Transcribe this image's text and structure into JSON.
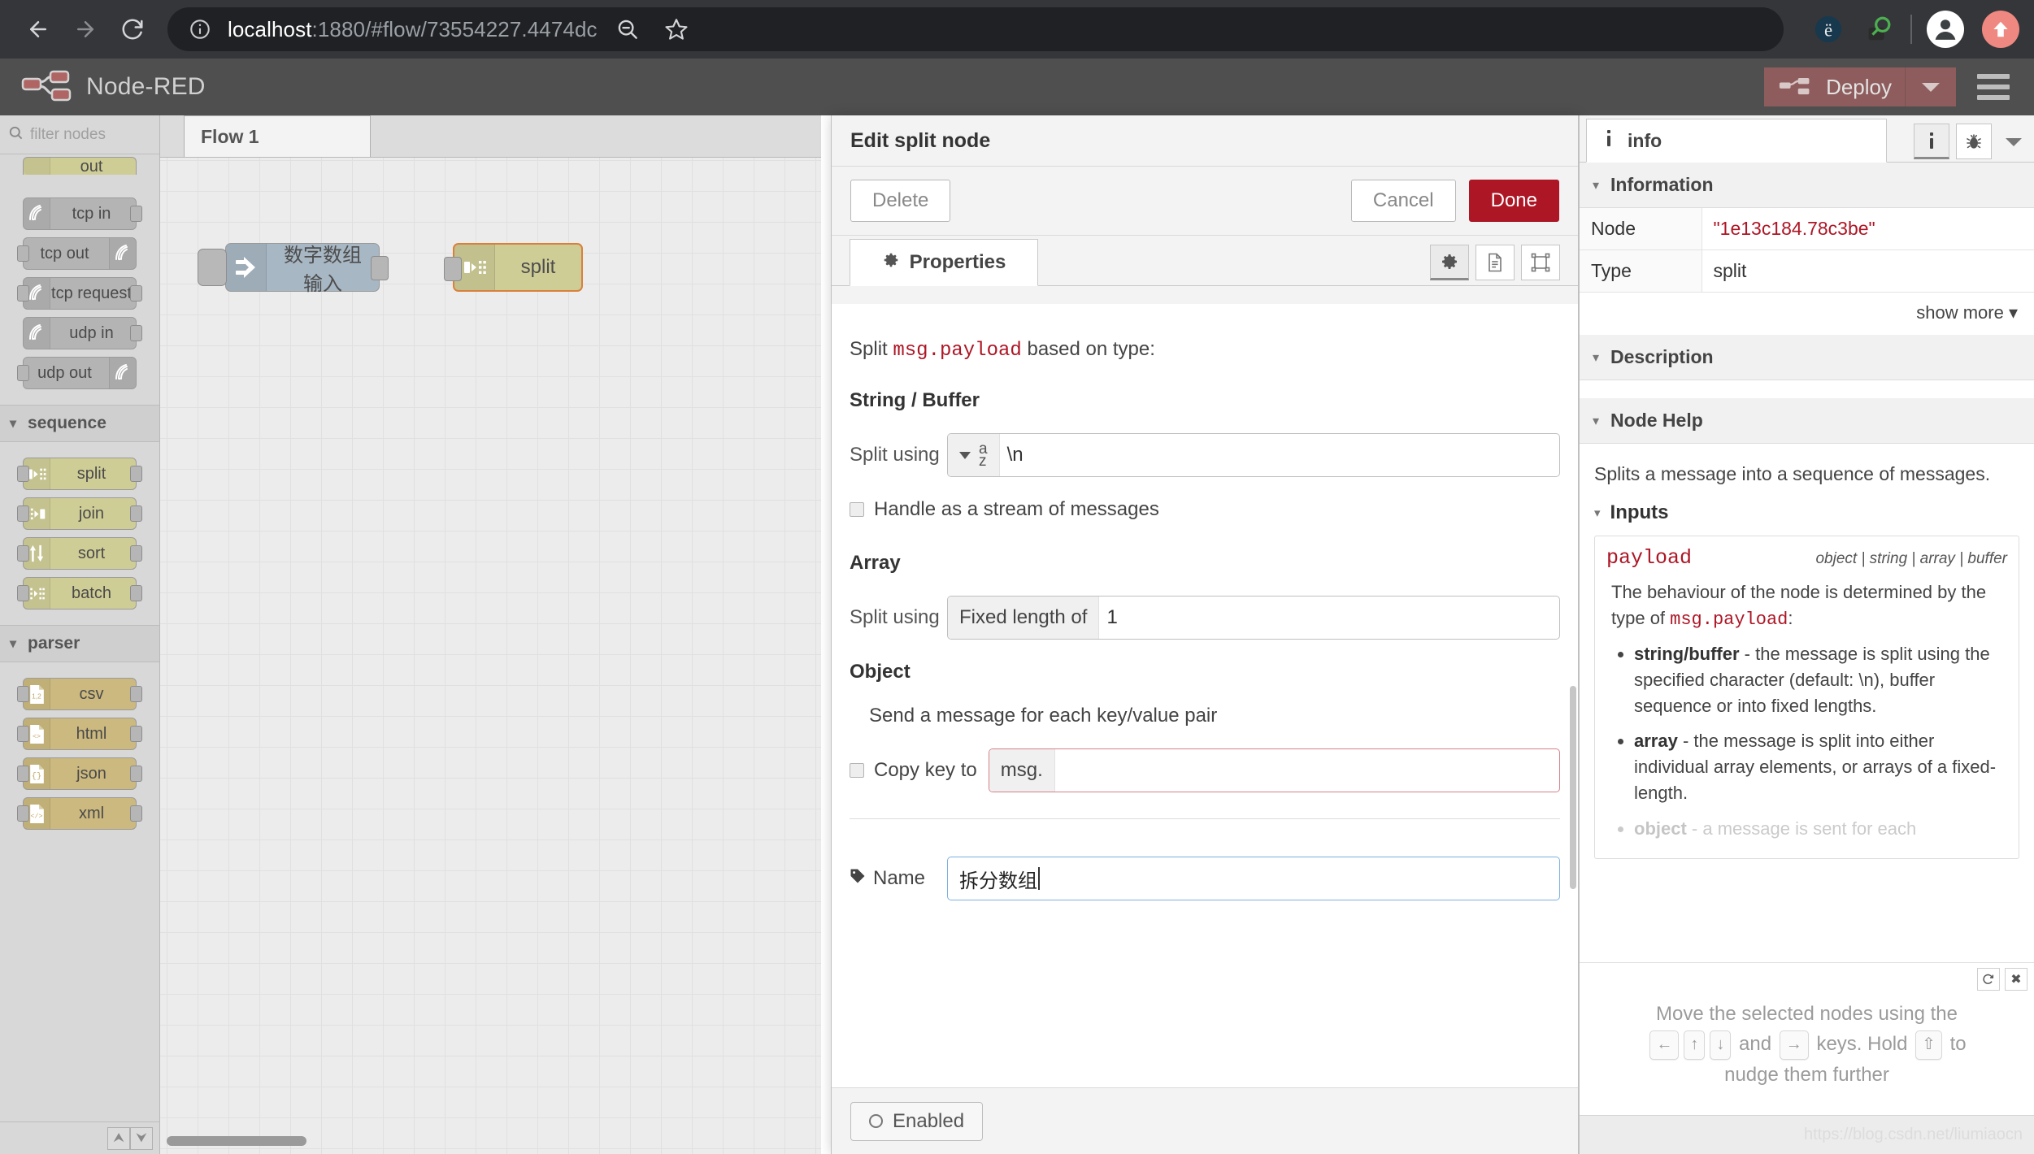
{
  "browser": {
    "url_host": "localhost",
    "url_rest": ":1880/#flow/73554227.4474dc",
    "back_icon": "back-arrow-icon",
    "forward_icon": "forward-arrow-icon",
    "reload_icon": "reload-icon",
    "site_info_icon": "site-info-icon",
    "zoom_out_icon": "zoom-out-icon",
    "bookmark_icon": "star-icon",
    "extension_e_icon": "extension-evernote-icon",
    "extension_search_icon": "extension-magnifier-icon",
    "profile_icon": "profile-avatar-icon",
    "update_icon": "update-arrow-icon"
  },
  "nr_header": {
    "title": "Node-RED",
    "logo_icon": "node-red-logo-icon",
    "deploy_label": "Deploy",
    "deploy_icon": "deploy-node-icon",
    "deploy_caret_icon": "chevron-down-icon",
    "menu_icon": "hamburger-menu-icon",
    "deploy_color": "#8e5c5c"
  },
  "palette": {
    "search_placeholder": "filter nodes",
    "search_icon": "search-icon",
    "partial_top_node": "out",
    "network_nodes": [
      {
        "label": "tcp in",
        "icon": "signal-icon",
        "color": "grey",
        "in": false,
        "out": true
      },
      {
        "label": "tcp out",
        "icon": "signal-icon",
        "color": "grey",
        "in": true,
        "out": false,
        "icon_right": true
      },
      {
        "label": "tcp request",
        "icon": "signal-icon",
        "color": "grey",
        "in": true,
        "out": true
      },
      {
        "label": "udp in",
        "icon": "signal-icon",
        "color": "grey",
        "in": false,
        "out": true
      },
      {
        "label": "udp out",
        "icon": "signal-icon",
        "color": "grey",
        "in": true,
        "out": false,
        "icon_right": true
      }
    ],
    "groups": [
      {
        "name": "sequence",
        "nodes": [
          {
            "label": "split",
            "icon": "split-icon",
            "color": "olive",
            "in": true,
            "out": true
          },
          {
            "label": "join",
            "icon": "join-icon",
            "color": "olive",
            "in": true,
            "out": true
          },
          {
            "label": "sort",
            "icon": "sort-arrows-icon",
            "color": "olive",
            "in": true,
            "out": true
          },
          {
            "label": "batch",
            "icon": "batch-icon",
            "color": "olive",
            "in": true,
            "out": true
          }
        ]
      },
      {
        "name": "parser",
        "nodes": [
          {
            "label": "csv",
            "icon": "csv-file-icon",
            "color": "tan",
            "in": true,
            "out": true
          },
          {
            "label": "html",
            "icon": "html-file-icon",
            "color": "tan",
            "in": true,
            "out": true
          },
          {
            "label": "json",
            "icon": "json-file-icon",
            "color": "tan",
            "in": true,
            "out": true
          },
          {
            "label": "xml",
            "icon": "xml-file-icon",
            "color": "tan",
            "in": true,
            "out": true
          }
        ]
      }
    ],
    "scroll_up_icon": "chevron-double-up-icon",
    "scroll_down_icon": "chevron-double-down-icon"
  },
  "workspace": {
    "tab_label": "Flow 1",
    "nodes": [
      {
        "label": "数字数组输入",
        "icon": "inject-arrow-icon",
        "color": "#a8b7c4"
      },
      {
        "label": "split",
        "icon": "split-icon",
        "color": "#cfcd96"
      }
    ]
  },
  "dialog": {
    "title": "Edit split node",
    "delete_label": "Delete",
    "cancel_label": "Cancel",
    "done_label": "Done",
    "tab_properties": "Properties",
    "tab_gear_icon": "gear-icon",
    "icon_buttons": [
      {
        "name": "properties-gear-icon",
        "glyph": "⚙"
      },
      {
        "name": "description-document-icon",
        "glyph": "὜E"
      },
      {
        "name": "appearance-icon",
        "glyph": "❑"
      }
    ],
    "split_prefix": "Split",
    "split_msgpayload": "msg.payload",
    "split_suffix": "based on type:",
    "section_string_buffer": "String / Buffer",
    "string_split_label": "Split using",
    "string_split_type_icon": "az-string-type-icon",
    "string_split_value": "\\n",
    "stream_checkbox_label": "Handle as a stream of messages",
    "section_array": "Array",
    "array_split_label": "Split using",
    "array_split_prefix": "Fixed length of",
    "array_split_value": "1",
    "section_object": "Object",
    "object_note": "Send a message for each key/value pair",
    "copy_key_label": "Copy key to",
    "copy_key_prefix": "msg.",
    "copy_key_value": "",
    "name_label": "Name",
    "name_icon": "tag-icon",
    "name_value": "拆分数组",
    "enabled_label": "Enabled",
    "enabled_icon": "circle-icon",
    "done_color": "#ad1625"
  },
  "sidebar": {
    "tab_label": "info",
    "tab_icon": "info-icon",
    "info_btn_icon": "info-icon",
    "debug_btn_icon": "bug-icon",
    "more_caret_icon": "chevron-down-icon",
    "section_information": "Information",
    "info_rows": [
      {
        "key": "Node",
        "value": "\"1e13c184.78c3be\"",
        "value_color": "#ad1625"
      },
      {
        "key": "Type",
        "value": "split",
        "value_color": "#333333"
      }
    ],
    "show_more": "show more",
    "show_more_caret": "caret-down-icon",
    "section_description": "Description",
    "section_node_help": "Node Help",
    "help_intro": "Splits a message into a sequence of messages.",
    "help_inputs_heading": "Inputs",
    "payload_name": "payload",
    "payload_types": "object | string | array | buffer",
    "payload_desc_pre": "The behaviour of the node is determined by the type of ",
    "payload_desc_code": "msg.payload",
    "payload_desc_post": ":",
    "payload_bullets": [
      {
        "term": "string/buffer",
        "text": " - the message is split using the specified character (default: \\n), buffer sequence or into fixed lengths."
      },
      {
        "term": "array",
        "text": " - the message is split into either individual array elements, or arrays of a fixed-length."
      },
      {
        "term": "object",
        "text": " - a message is sent for each"
      }
    ],
    "tip_refresh_icon": "refresh-icon",
    "tip_close_icon": "close-icon",
    "tip_text_1": "Move the selected nodes using the",
    "tip_keys_1": [
      "←",
      "↑",
      "↓"
    ],
    "tip_text_2": "and",
    "tip_keys_2": [
      "→"
    ],
    "tip_text_3": "keys. Hold",
    "tip_keys_3": [
      "⇧"
    ],
    "tip_text_4": "to",
    "tip_text_5": "nudge them further",
    "watermark": "https://blog.csdn.net/liumiaocn"
  }
}
